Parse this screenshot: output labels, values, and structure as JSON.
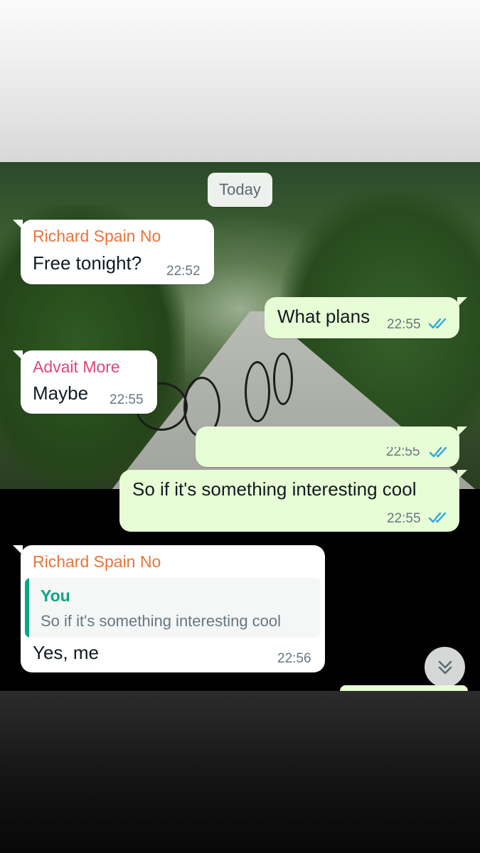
{
  "date_divider": "Today",
  "messages": [
    {
      "sender": "Richard Spain No",
      "text": "Free tonight?",
      "time": "22:52"
    },
    {
      "text": "What plans",
      "time": "22:55"
    },
    {
      "sender": "Advait More",
      "text": "Maybe",
      "time": "22:55"
    },
    {
      "text": "",
      "time": "22:55"
    },
    {
      "text": "So if it's something interesting cool",
      "time": "22:55"
    },
    {
      "sender": "Richard Spain No",
      "reply_to": {
        "author": "You",
        "text": "So if it's something interesting cool"
      },
      "text": "Yes, me",
      "time": "22:56"
    }
  ],
  "colors": {
    "incoming_bubble": "#ffffff",
    "outgoing_bubble": "#e7fdd5",
    "sender_richard": "#e8743b",
    "sender_advait": "#e0457b",
    "read_ticks": "#2ea6d9",
    "reply_accent": "#06a884",
    "timestamp": "#667781"
  },
  "icons": {
    "read_receipt": "double-check-icon",
    "scroll_down": "chevron-double-down-icon"
  }
}
